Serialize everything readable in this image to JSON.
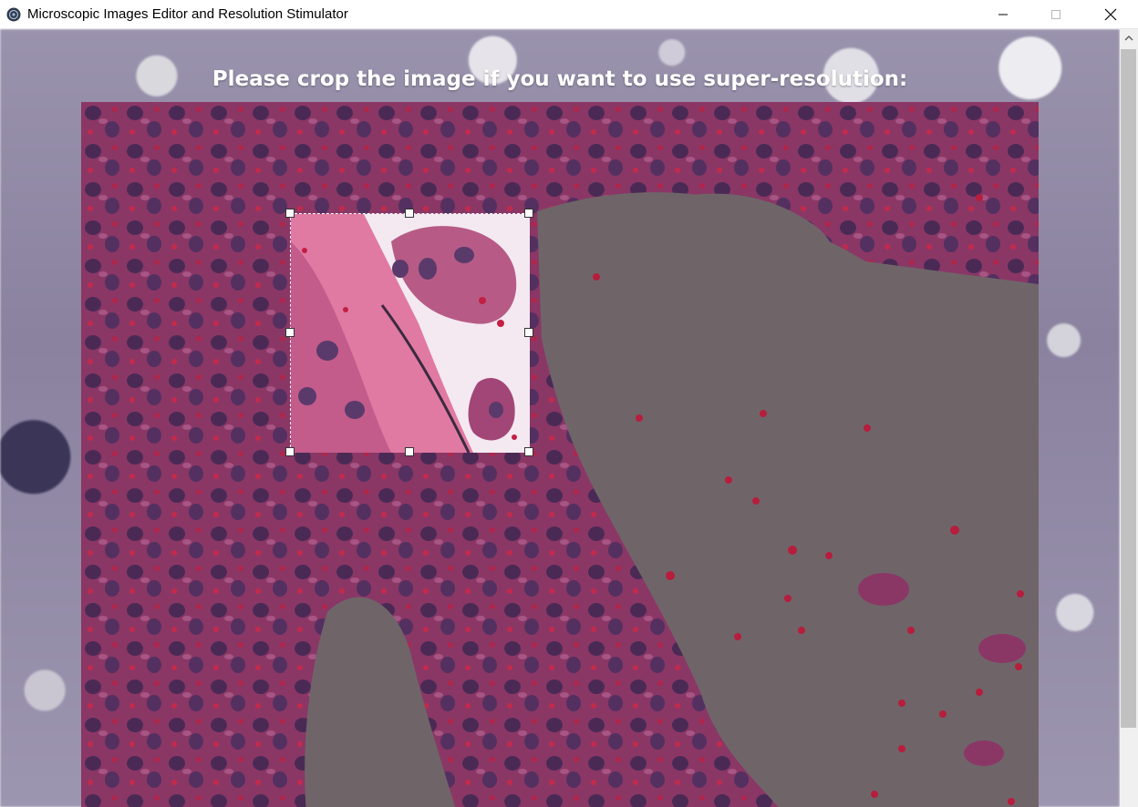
{
  "window": {
    "title": "Microscopic Images Editor and Resolution Stimulator",
    "app_icon": "app-logo-icon",
    "controls": {
      "minimize_icon": "minimize-icon",
      "maximize_icon": "maximize-icon",
      "close_icon": "close-icon"
    }
  },
  "main": {
    "heading": "Please crop the image if you want to use super-resolution:"
  },
  "crop": {
    "handle_icon": "crop-handle-icon",
    "handles": [
      "top-left",
      "top-middle",
      "top-right",
      "middle-left",
      "middle-right",
      "bottom-left",
      "bottom-middle",
      "bottom-right"
    ]
  },
  "scrollbar": {
    "up_icon": "scroll-up-arrow-icon",
    "orientation": "vertical"
  },
  "colors": {
    "overlay": "#6b5f6a",
    "tissue": "#9b3f73",
    "tissue_dark": "#6e2553",
    "crop_background": "#f4e9f1",
    "cell_pink": "#e07aa3"
  }
}
